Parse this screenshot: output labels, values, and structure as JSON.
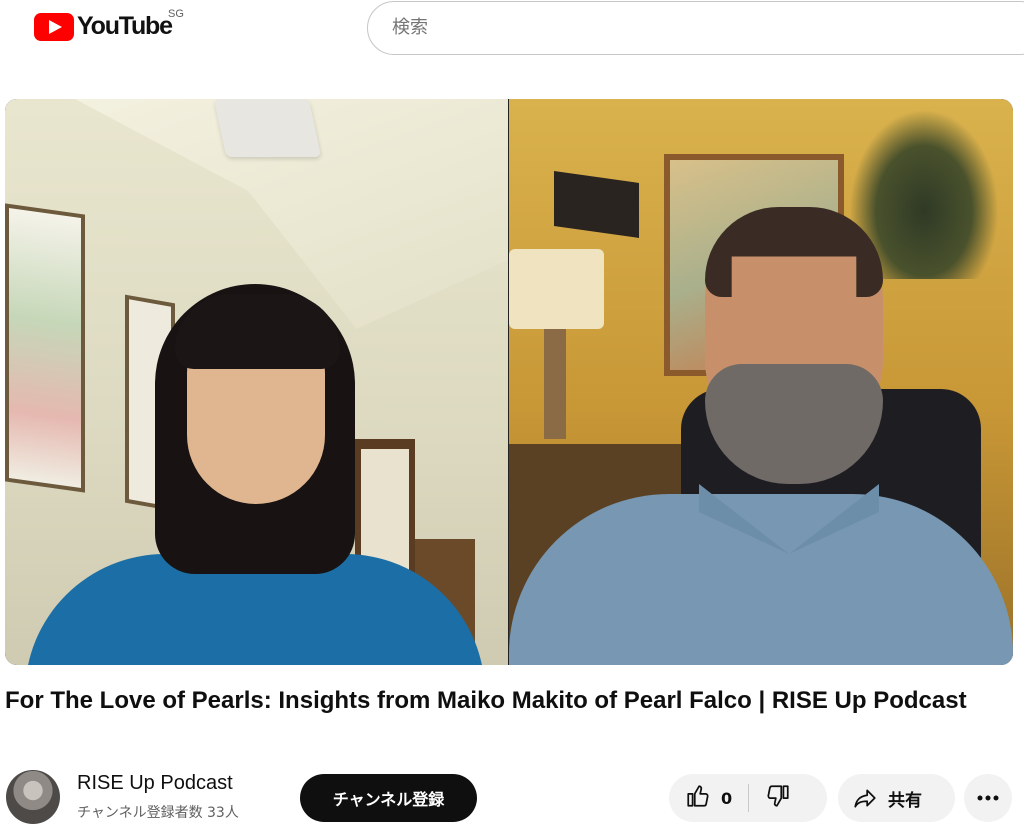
{
  "header": {
    "logo_text": "YouTube",
    "region": "SG",
    "search_placeholder": "検索"
  },
  "video": {
    "watermark_icon": "key-crown-icon",
    "title": "For The Love of Pearls: Insights from Maiko Makito of Pearl Falco | RISE Up Podcast"
  },
  "channel": {
    "name": "RISE Up Podcast",
    "subscribers": "チャンネル登録者数 33人",
    "subscribe_label": "チャンネル登録"
  },
  "actions": {
    "like_count": "0",
    "share_label": "共有",
    "icons": [
      "thumbs-up-icon",
      "thumbs-down-icon",
      "share-arrow-icon",
      "more-dots-icon"
    ]
  },
  "colors": {
    "brand_red": "#ff0000",
    "subscribe_bg": "#0f0f0f",
    "chip_bg": "#f2f2f2"
  }
}
